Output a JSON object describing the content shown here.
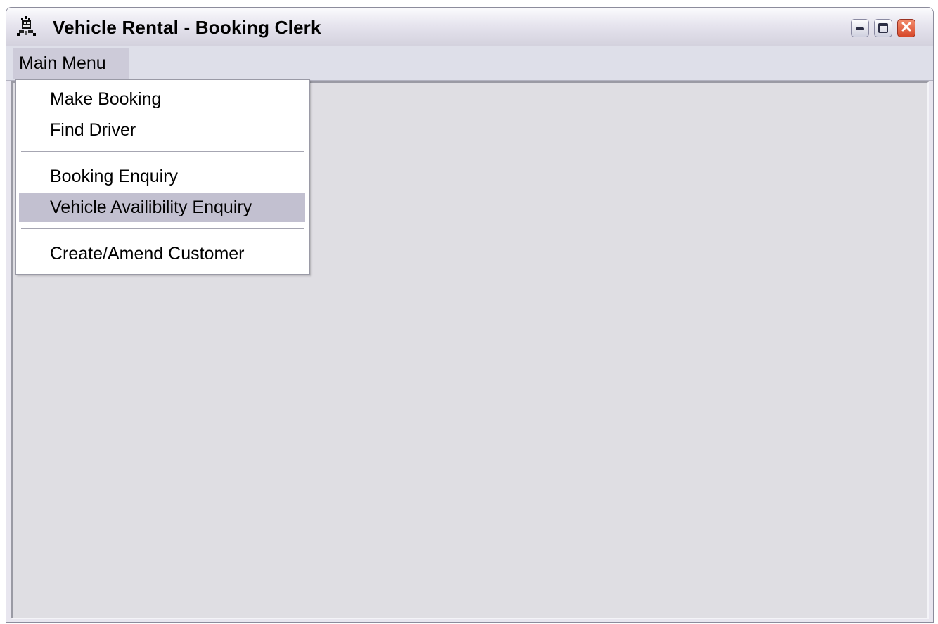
{
  "window": {
    "title": "Vehicle Rental - Booking Clerk",
    "icon": "app-icon",
    "controls": [
      "minimize-icon",
      "maximize-icon",
      "close-icon"
    ]
  },
  "menubar": {
    "items": [
      {
        "label": "Main Menu"
      }
    ]
  },
  "dropdown": {
    "items": [
      {
        "label": "Make Booking"
      },
      {
        "label": "Find Driver"
      },
      {
        "label": "Booking Enquiry"
      },
      {
        "label": "Vehicle Availibility Enquiry",
        "highlighted": true
      },
      {
        "label": "Create/Amend Customer"
      }
    ]
  },
  "colors": {
    "menu_highlight": "#c2c0d0",
    "client_background": "#dfdee3",
    "close_button": "#d7482a"
  }
}
